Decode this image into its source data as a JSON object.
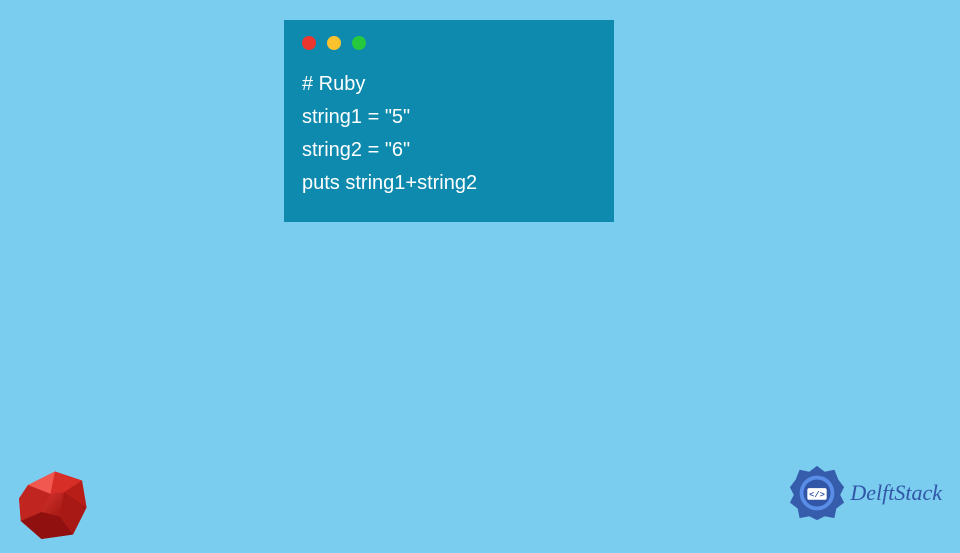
{
  "code": {
    "line1": "# Ruby",
    "line2": "string1 = \"5\"",
    "line3": "string2 = \"6\"",
    "line4": "puts string1+string2"
  },
  "branding": {
    "text": "DelftStack"
  }
}
